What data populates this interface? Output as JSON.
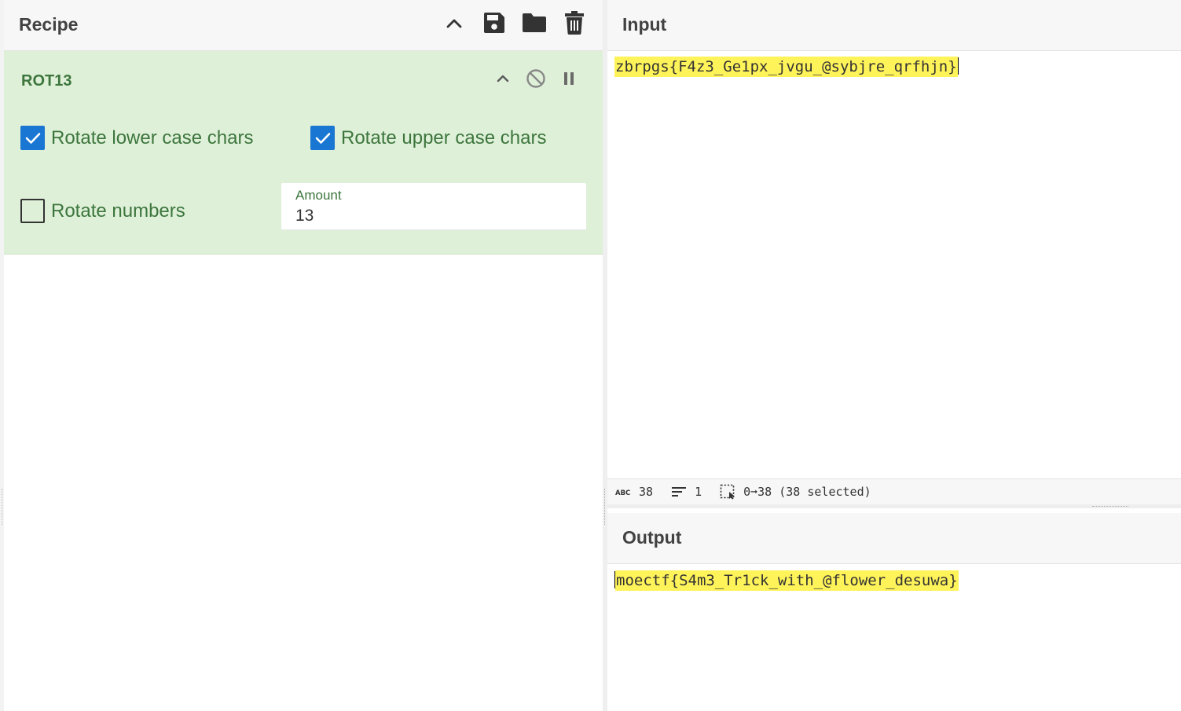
{
  "recipe": {
    "title": "Recipe",
    "operation": {
      "name": "ROT13",
      "options": {
        "rotate_lower": {
          "label": "Rotate lower case chars",
          "checked": true
        },
        "rotate_upper": {
          "label": "Rotate upper case chars",
          "checked": true
        },
        "rotate_numbers": {
          "label": "Rotate numbers",
          "checked": false
        }
      },
      "amount": {
        "label": "Amount",
        "value": "13"
      }
    }
  },
  "input": {
    "title": "Input",
    "text": "zbrpgs{F4z3_Ge1px_jvgu_@sybjre_qrfhjn}"
  },
  "status": {
    "length": "38",
    "lines": "1",
    "selection": "0➞38 (38 selected)"
  },
  "output": {
    "title": "Output",
    "text": "moectf{S4m3_Tr1ck_with_@flower_desuwa}"
  },
  "colors": {
    "accent_checkbox": "#1976d2",
    "operation_bg": "#dff0d8",
    "operation_text": "#3c763d",
    "highlight": "#fff35a"
  },
  "icons": [
    "chevron-up-icon",
    "save-icon",
    "folder-icon",
    "trash-icon",
    "disable-icon",
    "pause-icon",
    "text-length-icon",
    "lines-icon",
    "selection-icon"
  ]
}
